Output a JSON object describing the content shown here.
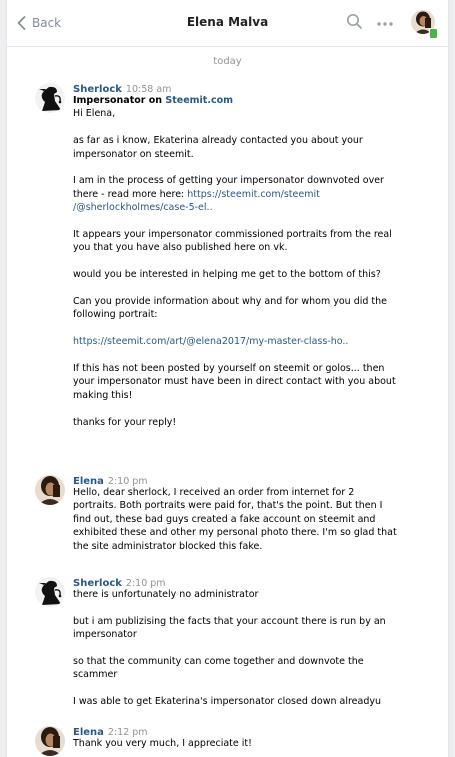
{
  "header": {
    "back_label": "Back",
    "title": "Elena Malva"
  },
  "date_divider": "today",
  "messages": [
    {
      "author": "Sherlock",
      "time": "10:58 am",
      "subject_prefix": "Impersonator on ",
      "subject_link": "Steemit.com",
      "lines": [
        "Hi Elena,",
        "as far as i know, Ekaterina already contacted you about your",
        "impersonator on steemit.",
        "I am in the process of getting your impersonator downvoted over",
        "there - read more here: ",
        "https://steemit.com/steemit",
        "/@sherlockholmes/case-5-el..",
        "It appears your impersonator commissioned portraits from the real",
        "you that you have also published here on vk.",
        "would you be interested in helping me get to the bottom of this?",
        "Can you provide information about why and for whom you did the",
        "following portrait:",
        "https://steemit.com/art/@elena2017/my-master-class-ho..",
        "If this has not been posted by yourself on steemit or golos... then",
        "your impersonator must have been in direct contact with you about",
        "making this!",
        "thanks for your reply!"
      ]
    },
    {
      "author": "Elena",
      "time": "2:10 pm",
      "lines": [
        "Hello, dear sherlock, I received an order from internet for 2",
        "portraits. Both portraits were paid for, that's the point. But then I",
        "find out, these bad guys created a fake account on steemit and",
        "exhibited these and other my personal photo there. I'm so glad that",
        "the site administrator blocked this fake."
      ]
    },
    {
      "author": "Sherlock",
      "time": "2:10 pm",
      "lines": [
        "there is unfortunately no administrator",
        "but i am publizising the facts that your account there is run by an",
        "impersonator",
        "so that the community can come together and downvote the",
        "scammer",
        "I was able to get Ekaterina's impersonator closed down alreadyu"
      ]
    },
    {
      "author": "Elena",
      "time": "2:12 pm",
      "lines": [
        "Thank you very much, I appreciate it!"
      ]
    }
  ],
  "icons": {
    "back": "chevron-left-icon",
    "search": "search-icon",
    "more": "more-dots-icon"
  },
  "colors": {
    "link": "#2a5885",
    "muted": "#939393",
    "online": "#4bb34b"
  }
}
